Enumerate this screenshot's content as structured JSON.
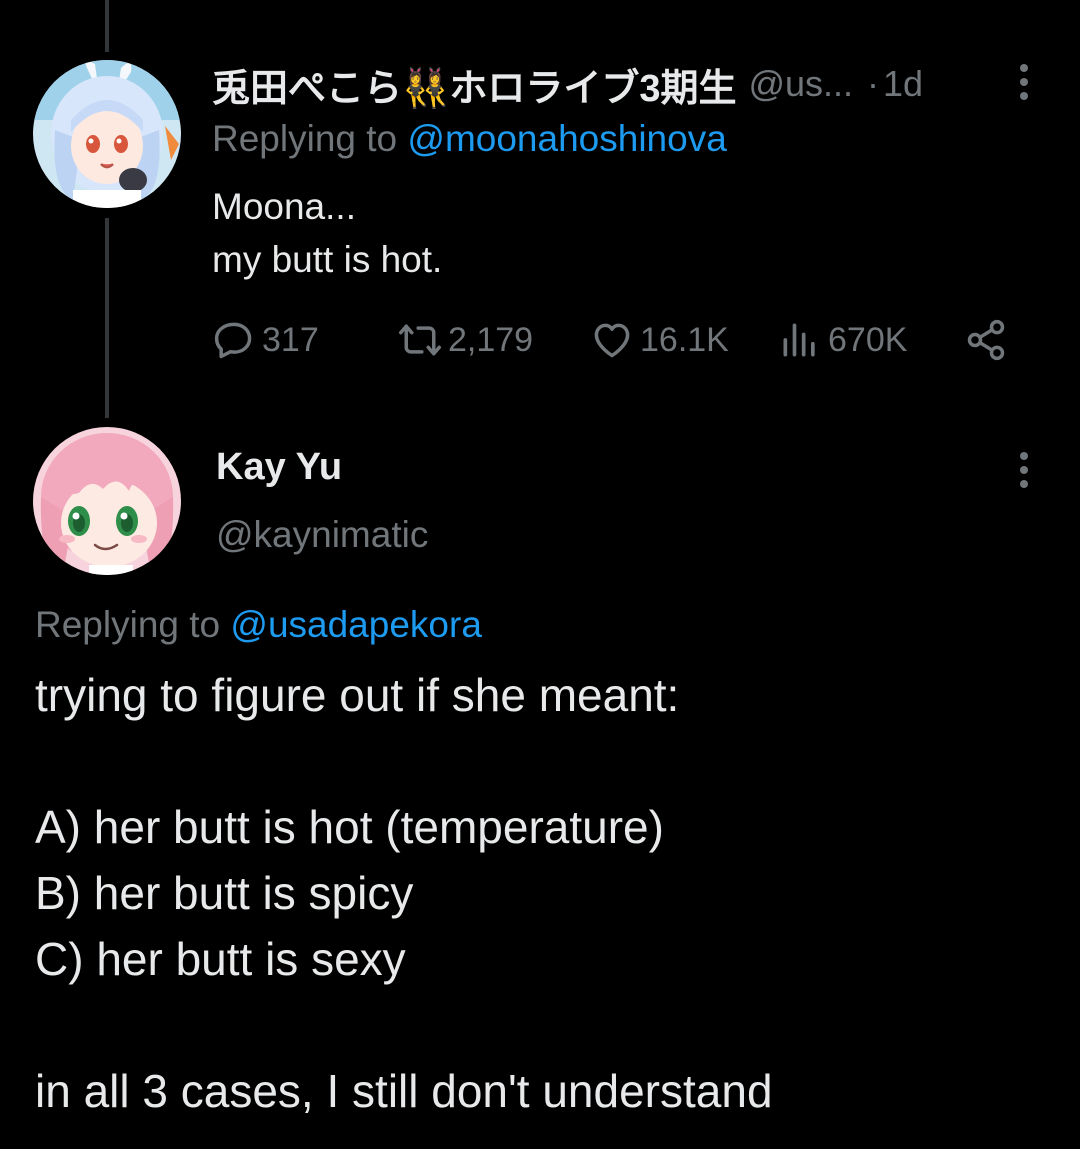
{
  "colors": {
    "background": "#000000",
    "text_primary": "#e7e9ea",
    "text_secondary": "#71767b",
    "link": "#1d9bf0",
    "thread_line": "#333639"
  },
  "tweet1": {
    "display_name": "兎田ぺこら👯‍♀️ホロライブ3期生",
    "handle": "@us...",
    "dot": "·",
    "time": "1d",
    "replying_prefix": "Replying to ",
    "replying_handle": "@moonahoshinova",
    "body_lines": [
      "Moona...",
      "my butt is hot."
    ],
    "stats": {
      "replies": "317",
      "retweets": "2,179",
      "likes": "16.1K",
      "views": "670K"
    },
    "icons": [
      "more-icon",
      "reply-icon",
      "retweet-icon",
      "like-icon",
      "views-icon",
      "share-icon"
    ]
  },
  "tweet2": {
    "display_name": "Kay Yu",
    "handle": "@kaynimatic",
    "replying_prefix": "Replying to ",
    "replying_handle": "@usadapekora",
    "body_lines": [
      "trying to figure out if she meant:",
      "",
      "A) her butt is hot (temperature)",
      "B) her butt is spicy",
      "C) her butt is sexy",
      "",
      "in all 3 cases, I still don't understand"
    ],
    "icons": [
      "more-icon"
    ]
  }
}
